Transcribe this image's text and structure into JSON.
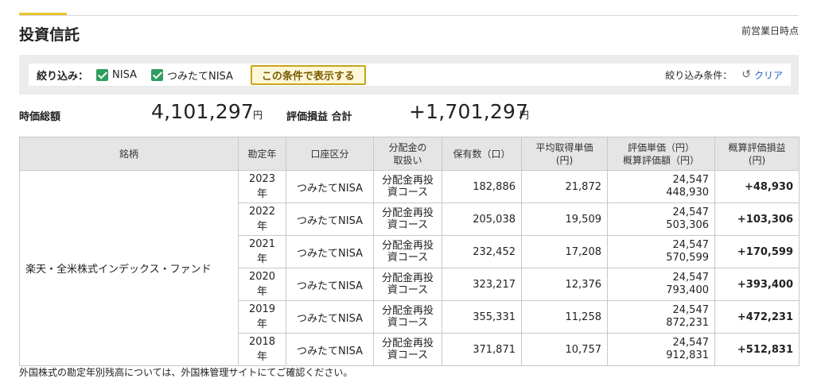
{
  "header": {
    "title": "投資信託",
    "as_of": "前営業日時点",
    "accent_color": "#e6c52e"
  },
  "filter": {
    "label": "絞り込み：",
    "options": [
      {
        "label": "NISA",
        "checked": true
      },
      {
        "label": "つみたてNISA",
        "checked": true
      }
    ],
    "apply_label": "この条件で表示する",
    "condition_label": "絞り込み条件：",
    "clear_label": "クリア",
    "check_color": "#2f9e5e"
  },
  "summary": {
    "market_value_label": "時価総額",
    "market_value": "4,101,297",
    "unit": "円",
    "pl_label": "評価損益 合計",
    "pl_value": "+1,701,297"
  },
  "table": {
    "headers": {
      "fund": "銘柄",
      "year": "勘定年",
      "account": "口座区分",
      "dist_l1": "分配金の",
      "dist_l2": "取扱い",
      "qty": "保有数（口）",
      "avg_l1": "平均取得単価",
      "avg_l2": "(円)",
      "eval_l1": "評価単価（円）",
      "eval_l2": "概算評価額（円）",
      "pl_l1": "概算評価損益",
      "pl_l2": "(円)"
    },
    "fund_name": "楽天・全米株式インデックス・ファンド",
    "rows": [
      {
        "year": "2023年",
        "account": "つみたてNISA",
        "dist_l1": "分配金再投",
        "dist_l2": "資コース",
        "qty": "182,886",
        "avg": "21,872",
        "unit_price": "24,547",
        "value": "448,930",
        "pl": "+48,930"
      },
      {
        "year": "2022年",
        "account": "つみたてNISA",
        "dist_l1": "分配金再投",
        "dist_l2": "資コース",
        "qty": "205,038",
        "avg": "19,509",
        "unit_price": "24,547",
        "value": "503,306",
        "pl": "+103,306"
      },
      {
        "year": "2021年",
        "account": "つみたてNISA",
        "dist_l1": "分配金再投",
        "dist_l2": "資コース",
        "qty": "232,452",
        "avg": "17,208",
        "unit_price": "24,547",
        "value": "570,599",
        "pl": "+170,599"
      },
      {
        "year": "2020年",
        "account": "つみたてNISA",
        "dist_l1": "分配金再投",
        "dist_l2": "資コース",
        "qty": "323,217",
        "avg": "12,376",
        "unit_price": "24,547",
        "value": "793,400",
        "pl": "+393,400"
      },
      {
        "year": "2019年",
        "account": "つみたてNISA",
        "dist_l1": "分配金再投",
        "dist_l2": "資コース",
        "qty": "355,331",
        "avg": "11,258",
        "unit_price": "24,547",
        "value": "872,231",
        "pl": "+472,231"
      },
      {
        "year": "2018年",
        "account": "つみたてNISA",
        "dist_l1": "分配金再投",
        "dist_l2": "資コース",
        "qty": "371,871",
        "avg": "10,757",
        "unit_price": "24,547",
        "value": "912,831",
        "pl": "+512,831"
      }
    ]
  },
  "note": "外国株式の勘定年別残高については、外国株管理サイトにてご確認ください。"
}
